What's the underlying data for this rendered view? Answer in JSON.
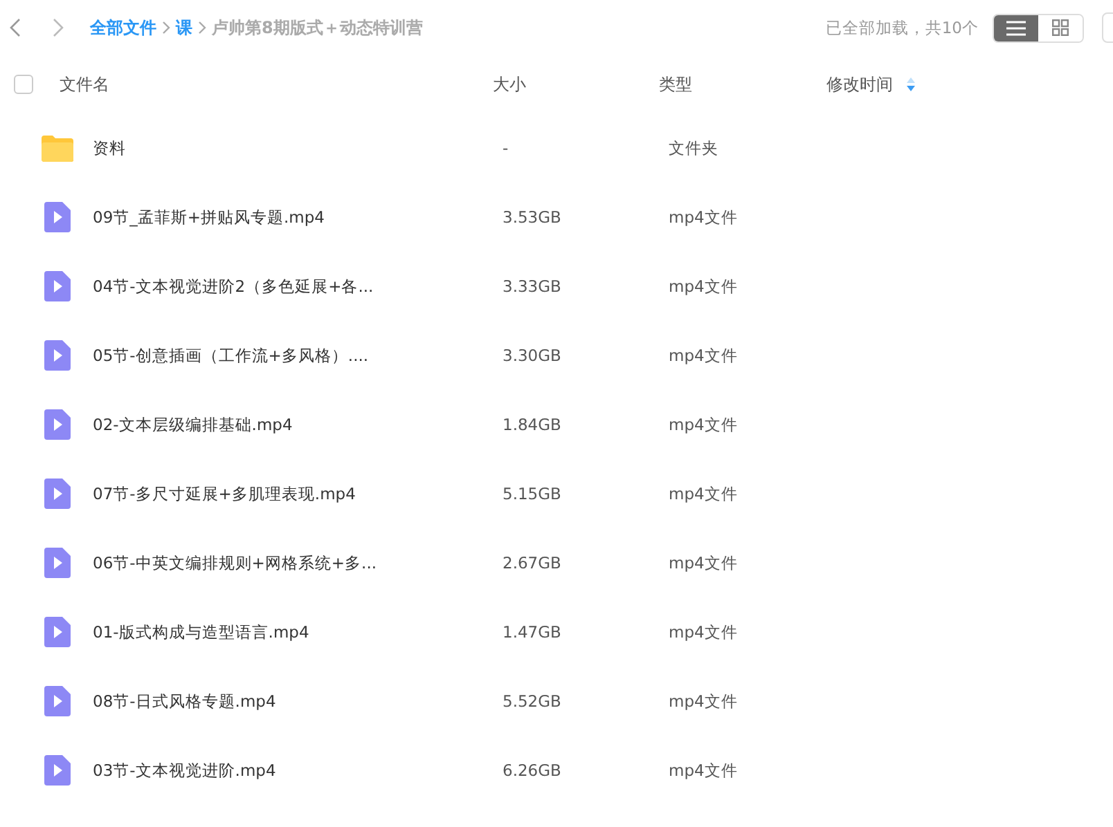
{
  "breadcrumb": [
    {
      "label": "全部文件",
      "kind": "link"
    },
    {
      "label": "课",
      "kind": "link"
    },
    {
      "label": "卢帅第8期版式＋动态特训营",
      "kind": "current"
    }
  ],
  "status": "已全部加载，共10个",
  "view_modes": [
    {
      "kind": "list",
      "selected": true
    },
    {
      "kind": "grid",
      "selected": false
    }
  ],
  "columns": [
    {
      "label": "文件名"
    },
    {
      "label": "大小"
    },
    {
      "label": "类型"
    },
    {
      "label": "修改时间",
      "sorted": true
    }
  ],
  "select_all": {
    "checked": false
  },
  "files": [
    {
      "kind": "folder",
      "name": "资料",
      "size": "-",
      "type": "文件夹"
    },
    {
      "kind": "video",
      "name": "09节_孟菲斯+拼贴风专题.mp4",
      "size": "3.53GB",
      "type": "mp4文件"
    },
    {
      "kind": "video",
      "name": "04节-文本视觉进阶2（多色延展+各...",
      "size": "3.33GB",
      "type": "mp4文件"
    },
    {
      "kind": "video",
      "name": "05节-创意插画（工作流+多风格）....",
      "size": "3.30GB",
      "type": "mp4文件"
    },
    {
      "kind": "video",
      "name": "02-文本层级编排基础.mp4",
      "size": "1.84GB",
      "type": "mp4文件"
    },
    {
      "kind": "video",
      "name": "07节-多尺寸延展+多肌理表现.mp4",
      "size": "5.15GB",
      "type": "mp4文件"
    },
    {
      "kind": "video",
      "name": "06节-中英文编排规则+网格系统+多...",
      "size": "2.67GB",
      "type": "mp4文件"
    },
    {
      "kind": "video",
      "name": "01-版式构成与造型语言.mp4",
      "size": "1.47GB",
      "type": "mp4文件"
    },
    {
      "kind": "video",
      "name": "08节-日式风格专题.mp4",
      "size": "5.52GB",
      "type": "mp4文件"
    },
    {
      "kind": "video",
      "name": "03节-文本视觉进阶.mp4",
      "size": "6.26GB",
      "type": "mp4文件"
    }
  ]
}
